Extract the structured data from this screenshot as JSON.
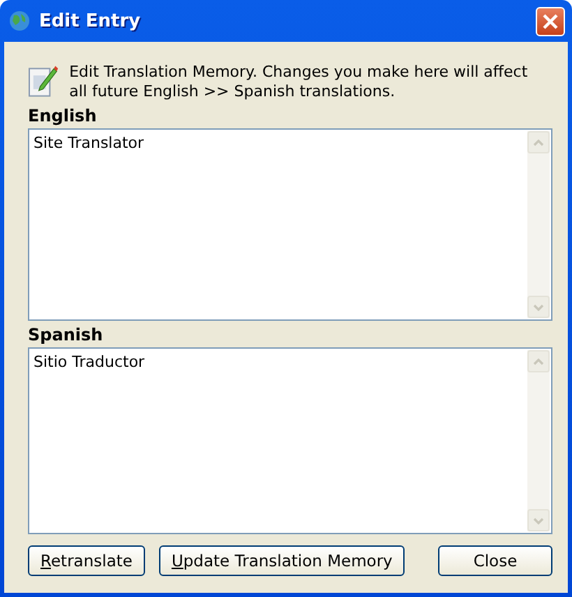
{
  "window": {
    "title": "Edit Entry"
  },
  "info": {
    "text": "Edit Translation Memory. Changes you make here will affect all future English >> Spanish translations."
  },
  "fields": [
    {
      "label": "English",
      "value": "Site Translator"
    },
    {
      "label": "Spanish",
      "value": "Sitio Traductor"
    }
  ],
  "action_buttons": [
    {
      "label": "Retranslate",
      "underline_first": true
    },
    {
      "label": "Update Translation Memory",
      "underline_first": true
    }
  ],
  "close_button": {
    "label": "Close",
    "underline_first": false
  }
}
